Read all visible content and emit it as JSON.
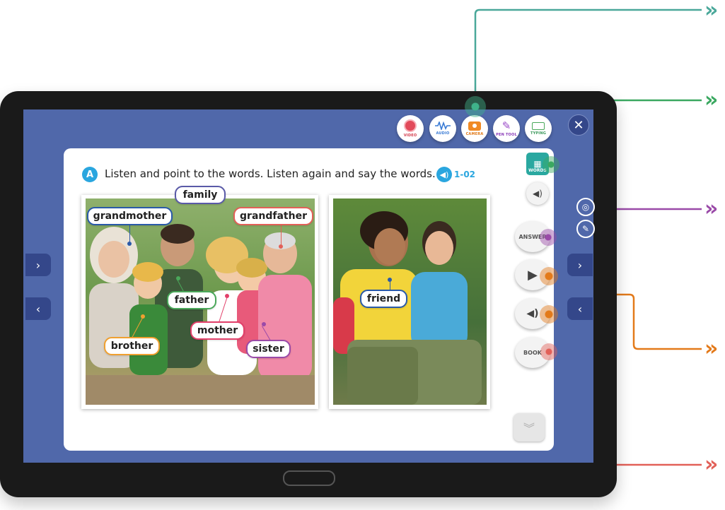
{
  "toolbar": {
    "video": "VIDEO",
    "audio": "AUDIO",
    "camera": "CAMERA",
    "pen": "PEN TOOL",
    "typing": "TYPING",
    "close": "✕"
  },
  "activity": {
    "badge": "A",
    "instruction": "Listen and point to the words. Listen again and say the words.",
    "track": "1-02"
  },
  "labels": {
    "family": "family",
    "grandmother": "grandmother",
    "grandfather": "grandfather",
    "father": "father",
    "mother": "mother",
    "brother": "brother",
    "sister": "sister",
    "friend": "friend"
  },
  "side_buttons": {
    "words": "WORDS",
    "answer": "ANSWER",
    "book": "BOOK"
  },
  "colors": {
    "screen": "#5068aa",
    "accent_blue": "#2aa6df",
    "callout_teal": "#4aa89a",
    "callout_green": "#3aa860",
    "callout_purple": "#9a4aa8",
    "callout_orange": "#e37a1a",
    "callout_red": "#e26058"
  }
}
